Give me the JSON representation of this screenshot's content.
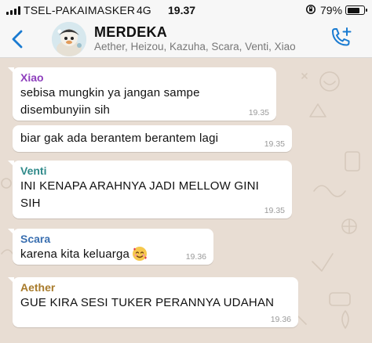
{
  "status_bar": {
    "carrier": "TSEL-PAKAIMASKER",
    "network": "4G",
    "time": "19.37",
    "battery_percent": "79%",
    "battery_level": 0.79
  },
  "header": {
    "group_name": "MERDEKA",
    "members": "Aether, Heizou, Kazuha, Scara, Venti, Xiao"
  },
  "colors": {
    "accent": "#1a7bd1",
    "xiao": "#8e3fbd",
    "venti": "#2f8a8a",
    "scara": "#3a6fb0",
    "aether": "#a87b2c"
  },
  "messages": [
    {
      "sender": "Xiao",
      "lines": [
        "sebisa mungkin ya jangan sampe",
        "disembunyiin sih"
      ],
      "time": "19.35"
    },
    {
      "sender": "",
      "lines": [
        "biar gak ada berantem berantem lagi"
      ],
      "time": "19.35"
    },
    {
      "sender": "Venti",
      "lines": [
        "INI KENAPA ARAHNYA JADI MELLOW GINI",
        "SIH"
      ],
      "time": "19.35"
    },
    {
      "sender": "Scara",
      "lines": [
        "karena kita keluarga"
      ],
      "emoji": "smiling-face-with-hearts",
      "time": "19.36"
    },
    {
      "sender": "Aether",
      "lines": [
        "GUE KIRA SESI TUKER PERANNYA UDAHAN"
      ],
      "time": "19.36"
    }
  ]
}
